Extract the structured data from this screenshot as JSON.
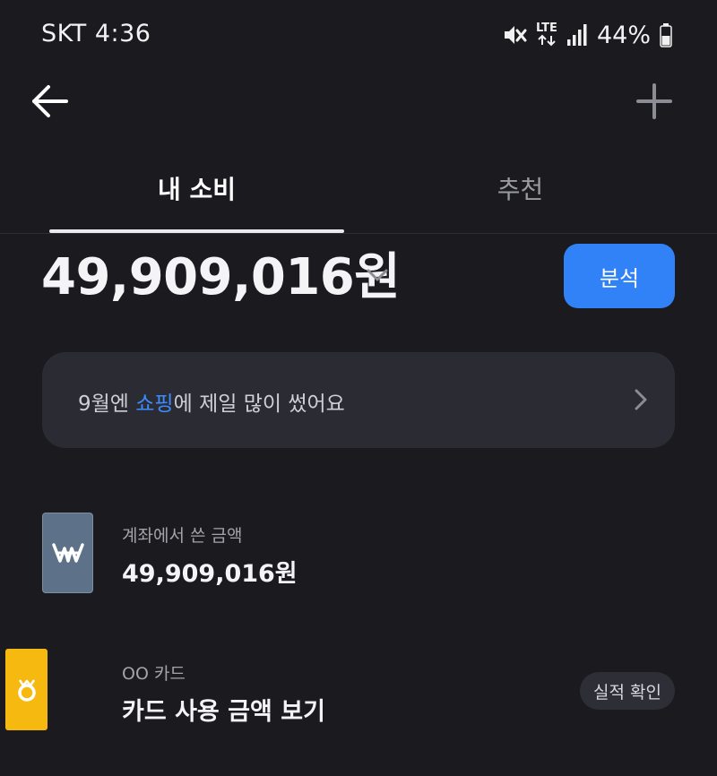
{
  "status_bar": {
    "carrier_time": "SKT 4:36",
    "network": "LTE",
    "battery": "44%",
    "icons": [
      "mute-icon",
      "lte-icon",
      "signal-icon",
      "battery-icon"
    ]
  },
  "nav": {
    "back_icon": "arrow-left-icon",
    "add_icon": "plus-icon"
  },
  "tabs": [
    {
      "label": "내 소비",
      "active": true
    },
    {
      "label": "추천",
      "active": false
    }
  ],
  "summary": {
    "total_amount": "49,909,016원",
    "analysis_label": "분석"
  },
  "insight": {
    "prefix": "9월엔 ",
    "highlight": "쇼핑",
    "suffix": "에 제일 많이 썼어요"
  },
  "account": {
    "label": "계좌에서 쓴 금액",
    "amount": "49,909,016원"
  },
  "card": {
    "label": "OO 카드",
    "title": "카드 사용 금액 보기",
    "action_label": "실적 확인"
  },
  "colors": {
    "background": "#1a1a1f",
    "accent": "#3182f6",
    "highlight": "#3d8bff",
    "card_panel": "#2b2c33",
    "account_icon": "#5d7288",
    "card_icon": "#f6b90f"
  }
}
